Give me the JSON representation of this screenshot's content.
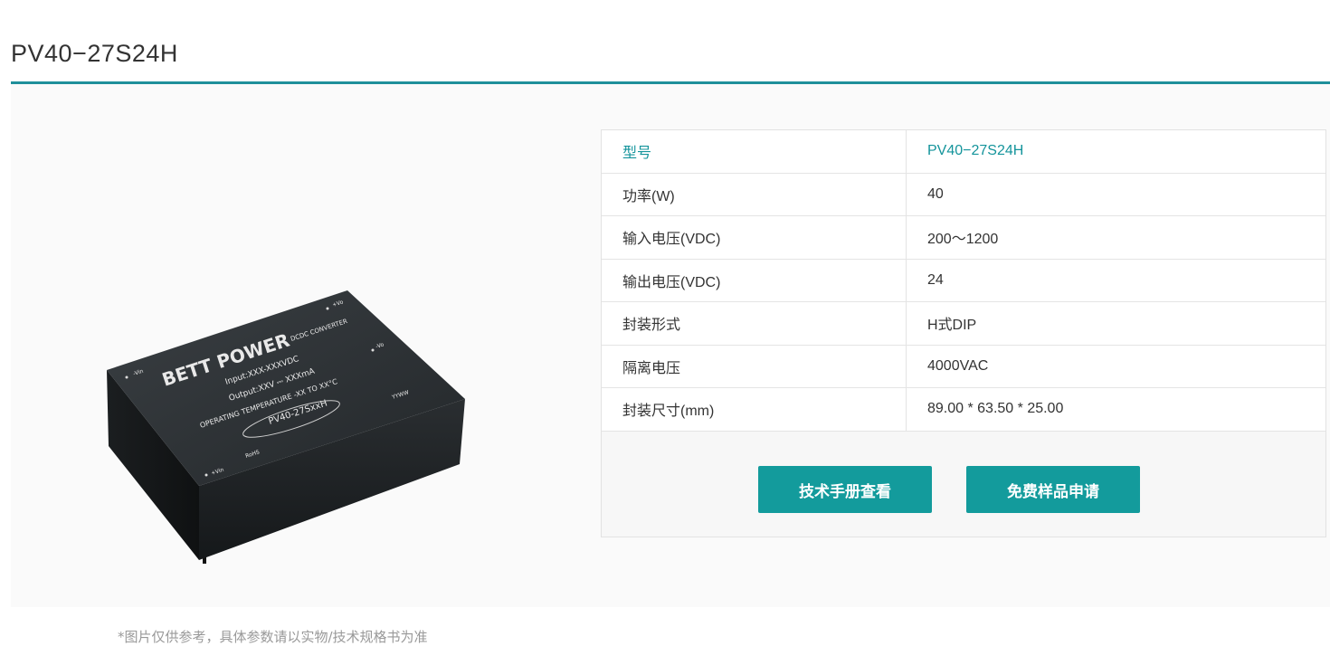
{
  "page": {
    "title": "PV40−27S24H"
  },
  "product_image": {
    "brand": "BETT POWER",
    "module_type": "DCDC CONVERTER",
    "lines": [
      "Input:XXX-XXXVDC",
      "Output:XXV ⎓ XXXmA",
      "OPERATING TEMPERATURE -XX TO XX°C"
    ],
    "model": "PV40-27SxxH",
    "date_code": "YYWW",
    "rohs": "RoHS",
    "pins": [
      "+Vo",
      "-Vo",
      "-Vin",
      "+Vin"
    ]
  },
  "caption": "*图片仅供参考，具体参数请以实物/技术规格书为准",
  "specs": {
    "header": {
      "key": "型号",
      "value": "PV40−27S24H"
    },
    "rows": [
      {
        "key": "功率(W)",
        "value": "40"
      },
      {
        "key": "输入电压(VDC)",
        "value": "200～1200"
      },
      {
        "key": "输出电压(VDC)",
        "value": "24"
      },
      {
        "key": "封装形式",
        "value": "H式DIP"
      },
      {
        "key": "隔离电压",
        "value": "4000VAC"
      },
      {
        "key": "封装尺寸(mm)",
        "value": "89.00 * 63.50 * 25.00"
      }
    ]
  },
  "buttons": {
    "datasheet": "技术手册查看",
    "sample": "免费样品申请"
  },
  "colors": {
    "accent": "#139b9c",
    "rule": "#1f8f9a",
    "module": "#2c3033"
  }
}
